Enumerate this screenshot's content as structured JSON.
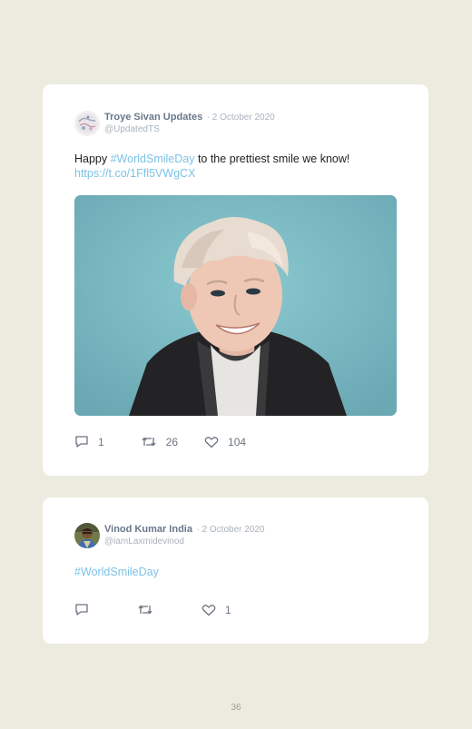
{
  "tweets": [
    {
      "name": "Troye Sivan Updates",
      "date": "· 2 October 2020",
      "handle": "@UpdatedTS",
      "text_prefix": "Happy ",
      "hashtag": "#WorldSmileDay",
      "text_suffix": " to the prettiest smile we know!",
      "link": "https://t.co/1Ffl5VWgCX",
      "replies": "1",
      "retweets": "26",
      "likes": "104"
    },
    {
      "name": "Vinod Kumar India",
      "date": "· 2 October 2020",
      "handle": "@iamLaxmidevinod",
      "hashtag": "#WorldSmileDay",
      "replies": "",
      "retweets": "",
      "likes": "1"
    }
  ],
  "page_number": "36",
  "colors": {
    "background": "#ecebdf",
    "card": "#ffffff",
    "link": "#7cc2e6",
    "name": "#68778a",
    "muted": "#a9b3bd"
  },
  "icons": [
    "reply-icon",
    "retweet-icon",
    "like-icon"
  ]
}
